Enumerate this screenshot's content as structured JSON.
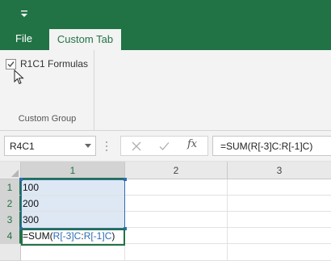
{
  "qat": {
    "customize_icon": "customize-quick-access-arrow-icon"
  },
  "tabs": {
    "file_label": "File",
    "custom_label": "Custom Tab"
  },
  "ribbon": {
    "checkbox_label": "R1C1 Formulas",
    "checkbox_checked": true,
    "group_label": "Custom Group"
  },
  "formula_bar": {
    "name_box_value": "R4C1",
    "fx_label": "fx",
    "formula": "=SUM(R[-3]C:R[-1]C)"
  },
  "grid": {
    "columns": [
      "1",
      "2",
      "3"
    ],
    "rows": [
      "1",
      "2",
      "3",
      "4"
    ],
    "cells": [
      "100",
      "200",
      "300"
    ],
    "edit_cell": {
      "prefix": "=SUM(",
      "ref_a": "R[-3]C",
      "colon": ":",
      "ref_b": "R[-1]C",
      "suffix": ")"
    }
  },
  "colors": {
    "accent": "#217346",
    "reference_blue": "#2f6bb5",
    "range_fill": "#dde8f4"
  }
}
